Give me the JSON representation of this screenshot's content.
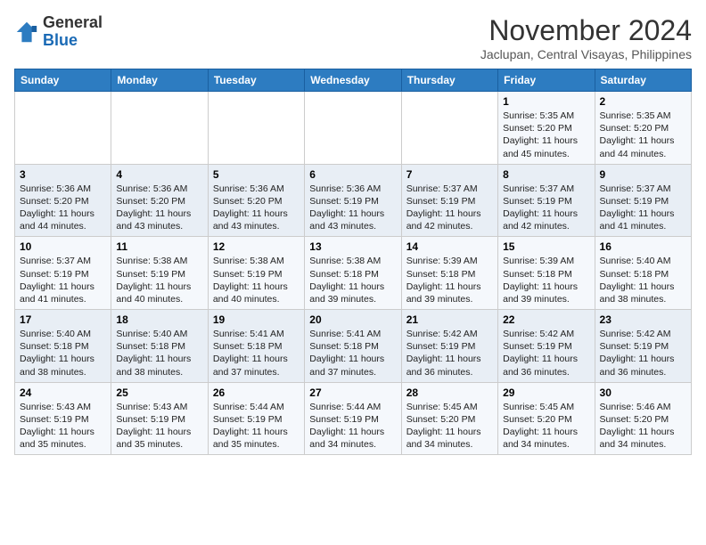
{
  "header": {
    "logo_general": "General",
    "logo_blue": "Blue",
    "month_title": "November 2024",
    "location": "Jaclupan, Central Visayas, Philippines"
  },
  "calendar": {
    "days_of_week": [
      "Sunday",
      "Monday",
      "Tuesday",
      "Wednesday",
      "Thursday",
      "Friday",
      "Saturday"
    ],
    "weeks": [
      [
        {
          "day": "",
          "info": ""
        },
        {
          "day": "",
          "info": ""
        },
        {
          "day": "",
          "info": ""
        },
        {
          "day": "",
          "info": ""
        },
        {
          "day": "",
          "info": ""
        },
        {
          "day": "1",
          "info": "Sunrise: 5:35 AM\nSunset: 5:20 PM\nDaylight: 11 hours and 45 minutes."
        },
        {
          "day": "2",
          "info": "Sunrise: 5:35 AM\nSunset: 5:20 PM\nDaylight: 11 hours and 44 minutes."
        }
      ],
      [
        {
          "day": "3",
          "info": "Sunrise: 5:36 AM\nSunset: 5:20 PM\nDaylight: 11 hours and 44 minutes."
        },
        {
          "day": "4",
          "info": "Sunrise: 5:36 AM\nSunset: 5:20 PM\nDaylight: 11 hours and 43 minutes."
        },
        {
          "day": "5",
          "info": "Sunrise: 5:36 AM\nSunset: 5:20 PM\nDaylight: 11 hours and 43 minutes."
        },
        {
          "day": "6",
          "info": "Sunrise: 5:36 AM\nSunset: 5:19 PM\nDaylight: 11 hours and 43 minutes."
        },
        {
          "day": "7",
          "info": "Sunrise: 5:37 AM\nSunset: 5:19 PM\nDaylight: 11 hours and 42 minutes."
        },
        {
          "day": "8",
          "info": "Sunrise: 5:37 AM\nSunset: 5:19 PM\nDaylight: 11 hours and 42 minutes."
        },
        {
          "day": "9",
          "info": "Sunrise: 5:37 AM\nSunset: 5:19 PM\nDaylight: 11 hours and 41 minutes."
        }
      ],
      [
        {
          "day": "10",
          "info": "Sunrise: 5:37 AM\nSunset: 5:19 PM\nDaylight: 11 hours and 41 minutes."
        },
        {
          "day": "11",
          "info": "Sunrise: 5:38 AM\nSunset: 5:19 PM\nDaylight: 11 hours and 40 minutes."
        },
        {
          "day": "12",
          "info": "Sunrise: 5:38 AM\nSunset: 5:19 PM\nDaylight: 11 hours and 40 minutes."
        },
        {
          "day": "13",
          "info": "Sunrise: 5:38 AM\nSunset: 5:18 PM\nDaylight: 11 hours and 39 minutes."
        },
        {
          "day": "14",
          "info": "Sunrise: 5:39 AM\nSunset: 5:18 PM\nDaylight: 11 hours and 39 minutes."
        },
        {
          "day": "15",
          "info": "Sunrise: 5:39 AM\nSunset: 5:18 PM\nDaylight: 11 hours and 39 minutes."
        },
        {
          "day": "16",
          "info": "Sunrise: 5:40 AM\nSunset: 5:18 PM\nDaylight: 11 hours and 38 minutes."
        }
      ],
      [
        {
          "day": "17",
          "info": "Sunrise: 5:40 AM\nSunset: 5:18 PM\nDaylight: 11 hours and 38 minutes."
        },
        {
          "day": "18",
          "info": "Sunrise: 5:40 AM\nSunset: 5:18 PM\nDaylight: 11 hours and 38 minutes."
        },
        {
          "day": "19",
          "info": "Sunrise: 5:41 AM\nSunset: 5:18 PM\nDaylight: 11 hours and 37 minutes."
        },
        {
          "day": "20",
          "info": "Sunrise: 5:41 AM\nSunset: 5:18 PM\nDaylight: 11 hours and 37 minutes."
        },
        {
          "day": "21",
          "info": "Sunrise: 5:42 AM\nSunset: 5:19 PM\nDaylight: 11 hours and 36 minutes."
        },
        {
          "day": "22",
          "info": "Sunrise: 5:42 AM\nSunset: 5:19 PM\nDaylight: 11 hours and 36 minutes."
        },
        {
          "day": "23",
          "info": "Sunrise: 5:42 AM\nSunset: 5:19 PM\nDaylight: 11 hours and 36 minutes."
        }
      ],
      [
        {
          "day": "24",
          "info": "Sunrise: 5:43 AM\nSunset: 5:19 PM\nDaylight: 11 hours and 35 minutes."
        },
        {
          "day": "25",
          "info": "Sunrise: 5:43 AM\nSunset: 5:19 PM\nDaylight: 11 hours and 35 minutes."
        },
        {
          "day": "26",
          "info": "Sunrise: 5:44 AM\nSunset: 5:19 PM\nDaylight: 11 hours and 35 minutes."
        },
        {
          "day": "27",
          "info": "Sunrise: 5:44 AM\nSunset: 5:19 PM\nDaylight: 11 hours and 34 minutes."
        },
        {
          "day": "28",
          "info": "Sunrise: 5:45 AM\nSunset: 5:20 PM\nDaylight: 11 hours and 34 minutes."
        },
        {
          "day": "29",
          "info": "Sunrise: 5:45 AM\nSunset: 5:20 PM\nDaylight: 11 hours and 34 minutes."
        },
        {
          "day": "30",
          "info": "Sunrise: 5:46 AM\nSunset: 5:20 PM\nDaylight: 11 hours and 34 minutes."
        }
      ]
    ]
  }
}
